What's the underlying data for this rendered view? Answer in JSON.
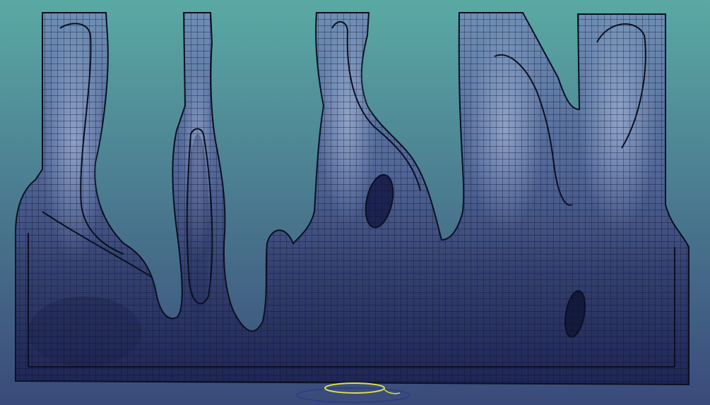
{
  "viewport": {
    "background_top": "#5aa9a4",
    "background_bottom": "#3a4a7a"
  },
  "mesh": {
    "fill_light": "#7e97bf",
    "fill_dark": "#202a5c",
    "wire_color": "#0b0f22"
  },
  "gizmo": {
    "ring_color": "#d9e04a",
    "ground_circle_color": "#2a3a8c"
  }
}
